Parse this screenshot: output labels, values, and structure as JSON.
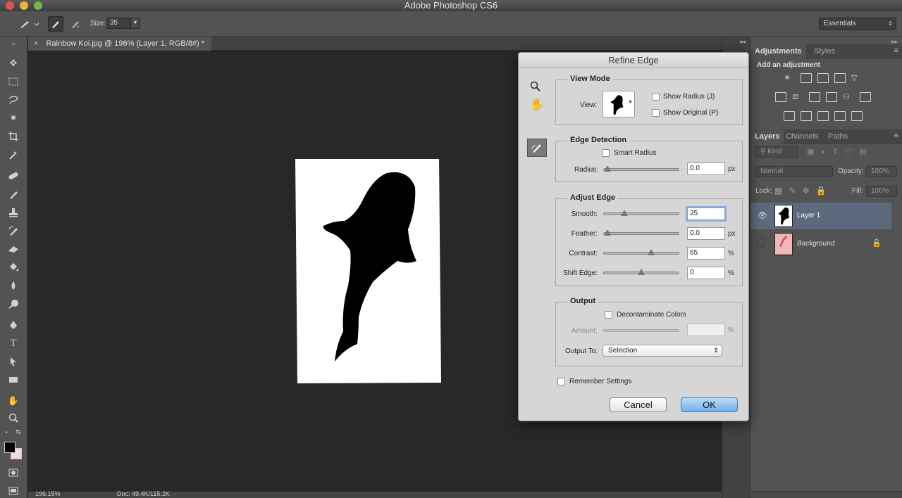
{
  "app": {
    "title": "Adobe Photoshop CS6"
  },
  "options_bar": {
    "size_label": "Size:",
    "size_value": "35",
    "workspace": "Essentials"
  },
  "document": {
    "tab_label": "Rainbow Koi.jpg @ 196% (Layer 1, RGB/8#) *",
    "close_glyph": "×"
  },
  "status_bar": {
    "zoom": "196.15%",
    "doc_info": "Doc: 49.4K/115.2K"
  },
  "adjustments_panel": {
    "tabs": [
      "Adjustments",
      "Styles"
    ],
    "hint": "Add an adjustment"
  },
  "layers_panel": {
    "tabs": [
      "Layers",
      "Channels",
      "Paths"
    ],
    "filter_kind": "Kind",
    "blend_mode": "Normal",
    "opacity_label": "Opacity:",
    "opacity_value": "100%",
    "lock_label": "Lock:",
    "fill_label": "Fill:",
    "fill_value": "100%",
    "layers": [
      {
        "name": "Layer 1",
        "visible": true,
        "selected": true
      },
      {
        "name": "Background",
        "visible": false,
        "selected": false,
        "locked": true
      }
    ]
  },
  "refine_edge": {
    "title": "Refine Edge",
    "view_mode": {
      "title": "View Mode",
      "view_label": "View:",
      "show_radius": "Show Radius (J)",
      "show_original": "Show Original (P)"
    },
    "edge_detection": {
      "title": "Edge Detection",
      "smart_radius": "Smart Radius",
      "radius_label": "Radius:",
      "radius_value": "0.0",
      "radius_unit": "px",
      "radius_fraction": 0.0
    },
    "adjust_edge": {
      "title": "Adjust Edge",
      "smooth_label": "Smooth:",
      "smooth_value": "25",
      "smooth_fraction": 0.25,
      "feather_label": "Feather:",
      "feather_value": "0.0",
      "feather_unit": "px",
      "feather_fraction": 0.0,
      "contrast_label": "Contrast:",
      "contrast_value": "65",
      "contrast_unit": "%",
      "contrast_fraction": 0.65,
      "shift_label": "Shift Edge:",
      "shift_value": "0",
      "shift_unit": "%",
      "shift_fraction": 0.5
    },
    "output": {
      "title": "Output",
      "decontaminate": "Decontaminate Colors",
      "amount_label": "Amount:",
      "amount_unit": "%",
      "output_to_label": "Output To:",
      "output_to_value": "Selection"
    },
    "remember_settings": "Remember Settings",
    "cancel": "Cancel",
    "ok": "OK"
  }
}
